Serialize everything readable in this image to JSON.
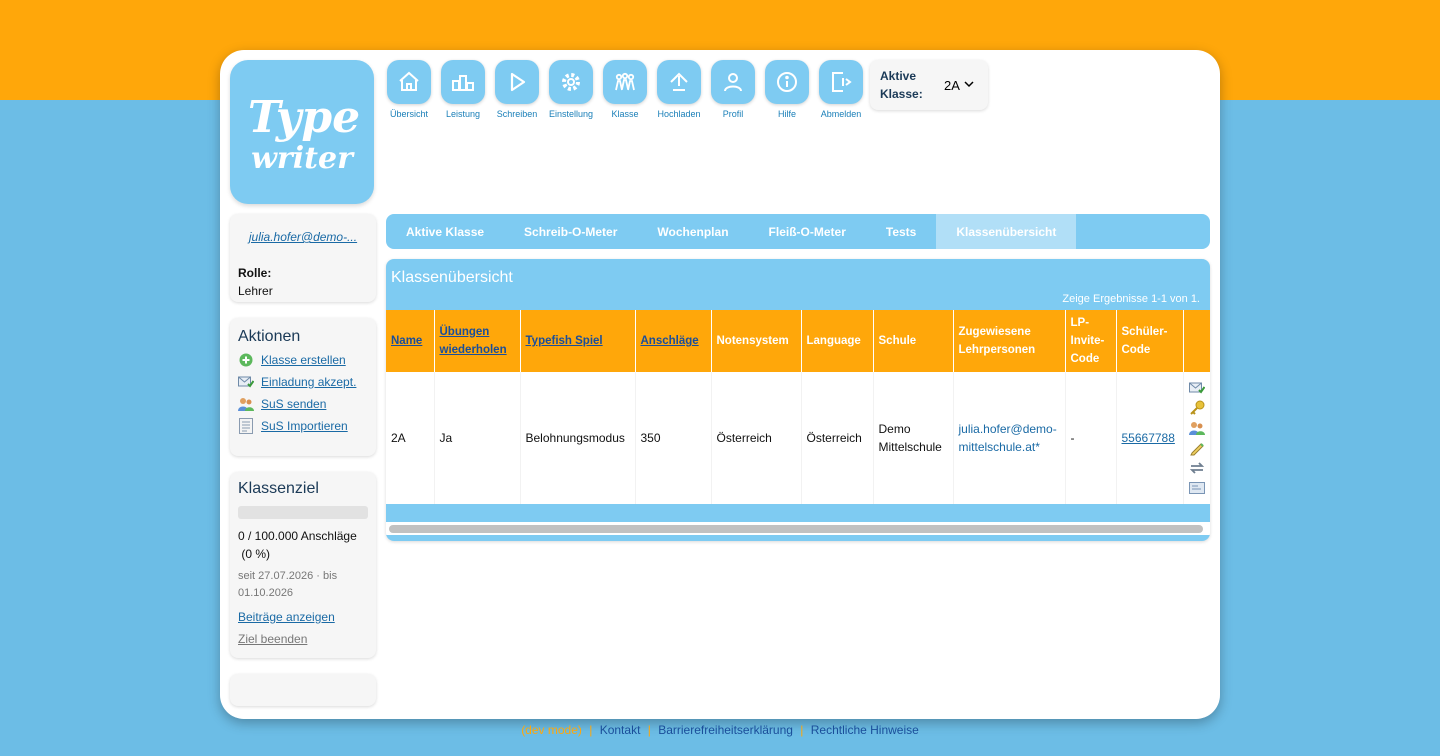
{
  "logo": {
    "line1": "Type",
    "line2": "writer"
  },
  "nav": {
    "items": [
      {
        "label": "Übersicht",
        "icon": "home-icon"
      },
      {
        "label": "Leistung",
        "icon": "podium-icon"
      },
      {
        "label": "Schreiben",
        "icon": "play-icon"
      },
      {
        "label": "Einstellung",
        "icon": "gear-icon"
      },
      {
        "label": "Klasse",
        "icon": "group-icon"
      },
      {
        "label": "Hochladen",
        "icon": "upload-icon"
      },
      {
        "label": "Profil",
        "icon": "user-icon"
      },
      {
        "label": "Hilfe",
        "icon": "info-icon"
      },
      {
        "label": "Abmelden",
        "icon": "logout-icon"
      }
    ]
  },
  "active_class": {
    "label": "Aktive Klasse:",
    "value": "2A"
  },
  "user": {
    "email": "julia.hofer@demo-...",
    "role_label": "Rolle:",
    "role_value": "Lehrer"
  },
  "actions": {
    "title": "Aktionen",
    "items": [
      {
        "label": "Klasse erstellen",
        "icon": "add-circle-icon"
      },
      {
        "label": "Einladung akzept.",
        "icon": "mail-accept-icon"
      },
      {
        "label": "SuS senden",
        "icon": "users-send-icon"
      },
      {
        "label": "SuS Importieren",
        "icon": "import-list-icon"
      }
    ]
  },
  "goal": {
    "title": "Klassenziel",
    "progress_percent": 0,
    "progress_text": "0 / 100.000 Anschläge",
    "percent_text": "(0 %)",
    "dates_text": "seit 27.07.2026 · bis 01.10.2026",
    "show_link": "Beiträge anzeigen",
    "end_link": "Ziel beenden"
  },
  "tabs": [
    {
      "label": "Aktive Klasse",
      "active": false
    },
    {
      "label": "Schreib-O-Meter",
      "active": false
    },
    {
      "label": "Wochenplan",
      "active": false
    },
    {
      "label": "Fleiß-O-Meter",
      "active": false
    },
    {
      "label": "Tests",
      "active": false
    },
    {
      "label": "Klassenübersicht",
      "active": true
    }
  ],
  "panel": {
    "title": "Klassenübersicht",
    "results": "Zeige Ergebnisse 1-1 von 1.",
    "columns": {
      "name": "Name",
      "repeat": "Übungen wiederholen",
      "typefish": "Typefish Spiel",
      "strokes": "Anschläge",
      "grading": "Notensystem",
      "language": "Language",
      "school": "Schule",
      "teachers": "Zugewiesene Lehrpersonen",
      "lp_code": "LP-Invite-Code",
      "student_code": "Schüler-Code"
    },
    "rows": [
      {
        "name": "2A",
        "repeat": "Ja",
        "typefish": "Belohnungsmodus",
        "strokes": "350",
        "grading": "Österreich",
        "language": "Österreich",
        "school": "Demo Mittelschule",
        "teachers": "julia.hofer@demo-mittelschule.at*",
        "lp_code": "-",
        "student_code": "55667788"
      }
    ],
    "row_actions": [
      "mail-accept-icon",
      "key-icon",
      "users-icon",
      "pencil-icon",
      "transfer-icon",
      "card-icon"
    ]
  },
  "footer": {
    "version": "(dev mode)",
    "links": [
      "Kontakt",
      "Barrierefreiheitserklärung",
      "Rechtliche Hinweise"
    ]
  }
}
